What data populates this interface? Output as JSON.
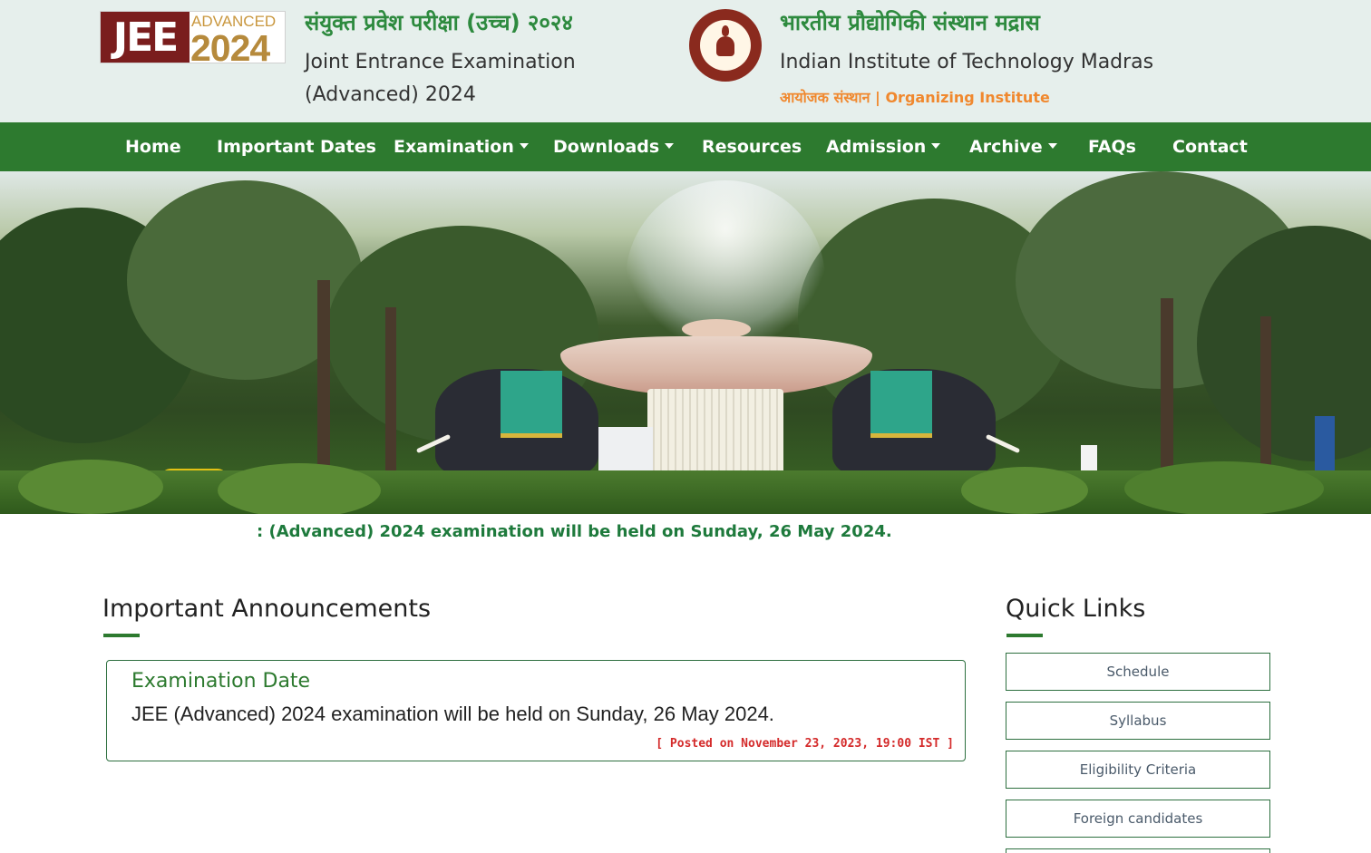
{
  "header": {
    "logo": {
      "word": "JEE",
      "line1": "ADVANCED",
      "year": "2024"
    },
    "exam_title_hindi": "संयुक्त प्रवेश परीक्षा (उच्च) २०२४",
    "exam_title_en_line1": "Joint Entrance Examination",
    "exam_title_en_line2": "(Advanced) 2024",
    "institute_hindi": "भारतीय प्रौद्योगिकी संस्थान मद्रास",
    "institute_en": "Indian Institute of Technology Madras",
    "organizing": "आयोजक संस्थान | Organizing Institute"
  },
  "nav": {
    "items": [
      {
        "label": "Home",
        "dropdown": false
      },
      {
        "label": "Important Dates",
        "dropdown": false
      },
      {
        "label": "Examination",
        "dropdown": true
      },
      {
        "label": "Downloads",
        "dropdown": true
      },
      {
        "label": "Resources",
        "dropdown": false
      },
      {
        "label": "Admission",
        "dropdown": true
      },
      {
        "label": "Archive",
        "dropdown": true
      },
      {
        "label": "FAQs",
        "dropdown": false
      },
      {
        "label": "Contact",
        "dropdown": false
      }
    ]
  },
  "ticker": {
    "text": ": (Advanced) 2024 examination will be held on Sunday, 26 May 2024."
  },
  "announcements": {
    "title": "Important Announcements",
    "items": [
      {
        "title": "Examination Date",
        "body": "JEE (Advanced) 2024 examination will be held on Sunday, 26 May 2024.",
        "posted": "[ Posted on November 23, 2023, 19:00 IST ]"
      }
    ]
  },
  "quick_links": {
    "title": "Quick Links",
    "items": [
      "Schedule",
      "Syllabus",
      "Eligibility Criteria",
      "Foreign candidates"
    ]
  },
  "colors": {
    "nav_green": "#2d7a2f",
    "header_bg": "#e6efec",
    "hindi_green": "#2d8a3e",
    "organizing_orange": "#f0882e",
    "posted_red": "#d42a2a",
    "jee_maroon": "#7a1d1d"
  }
}
